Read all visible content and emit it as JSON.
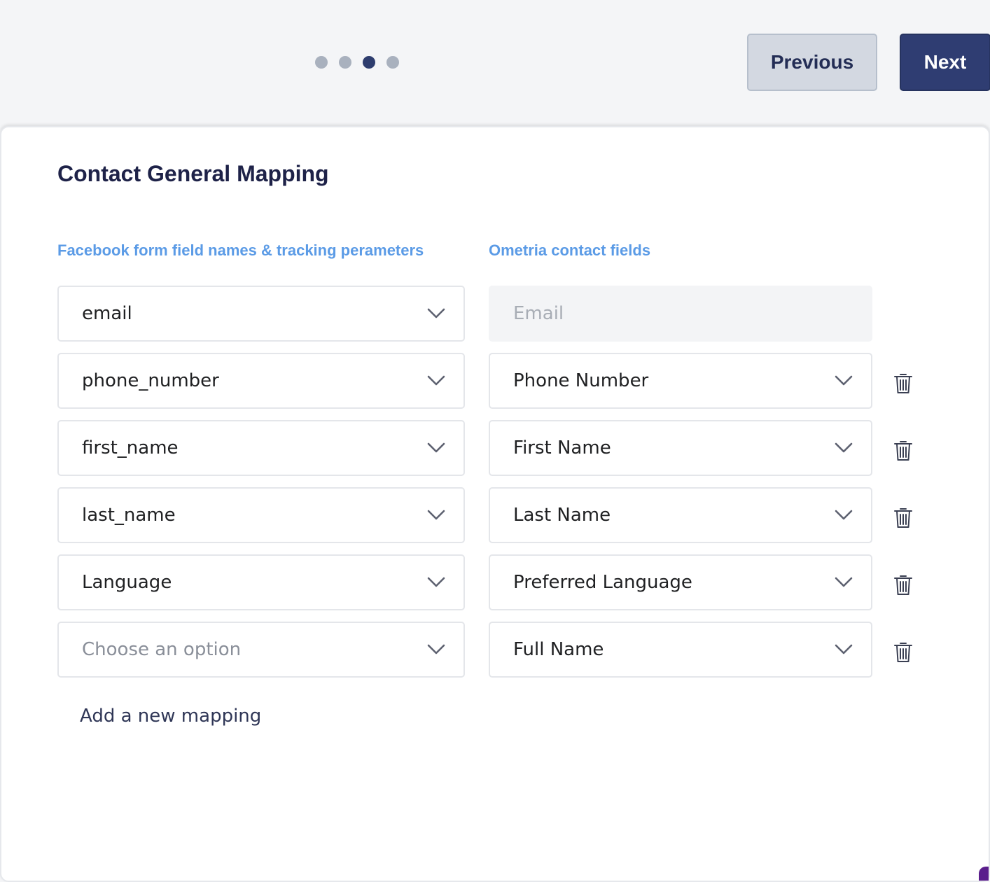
{
  "stepper": {
    "steps": [
      {
        "state": "complete"
      },
      {
        "state": "complete"
      },
      {
        "state": "current"
      },
      {
        "state": "upcoming"
      }
    ]
  },
  "nav": {
    "previous_label": "Previous",
    "next_label": "Next"
  },
  "card": {
    "title": "Contact General Mapping",
    "left_column_header": "Facebook form field names & tracking perameters",
    "right_column_header": "Ometria contact fields",
    "add_mapping_label": "Add a new mapping"
  },
  "mappings": [
    {
      "source": "email",
      "target": "Email",
      "target_locked": true
    },
    {
      "source": "phone_number",
      "target": "Phone Number"
    },
    {
      "source": "first_name",
      "target": "First Name"
    },
    {
      "source": "last_name",
      "target": "Last Name"
    },
    {
      "source": "Language",
      "target": "Preferred Language"
    },
    {
      "source": "Choose an option",
      "source_is_placeholder": true,
      "target": "Full Name"
    }
  ],
  "colors": {
    "accent": "#2f3d72",
    "column_header": "#5b9be6",
    "title": "#1e2248"
  },
  "icons": {
    "dropdown": "chevron-down-icon",
    "delete": "trash-icon"
  }
}
